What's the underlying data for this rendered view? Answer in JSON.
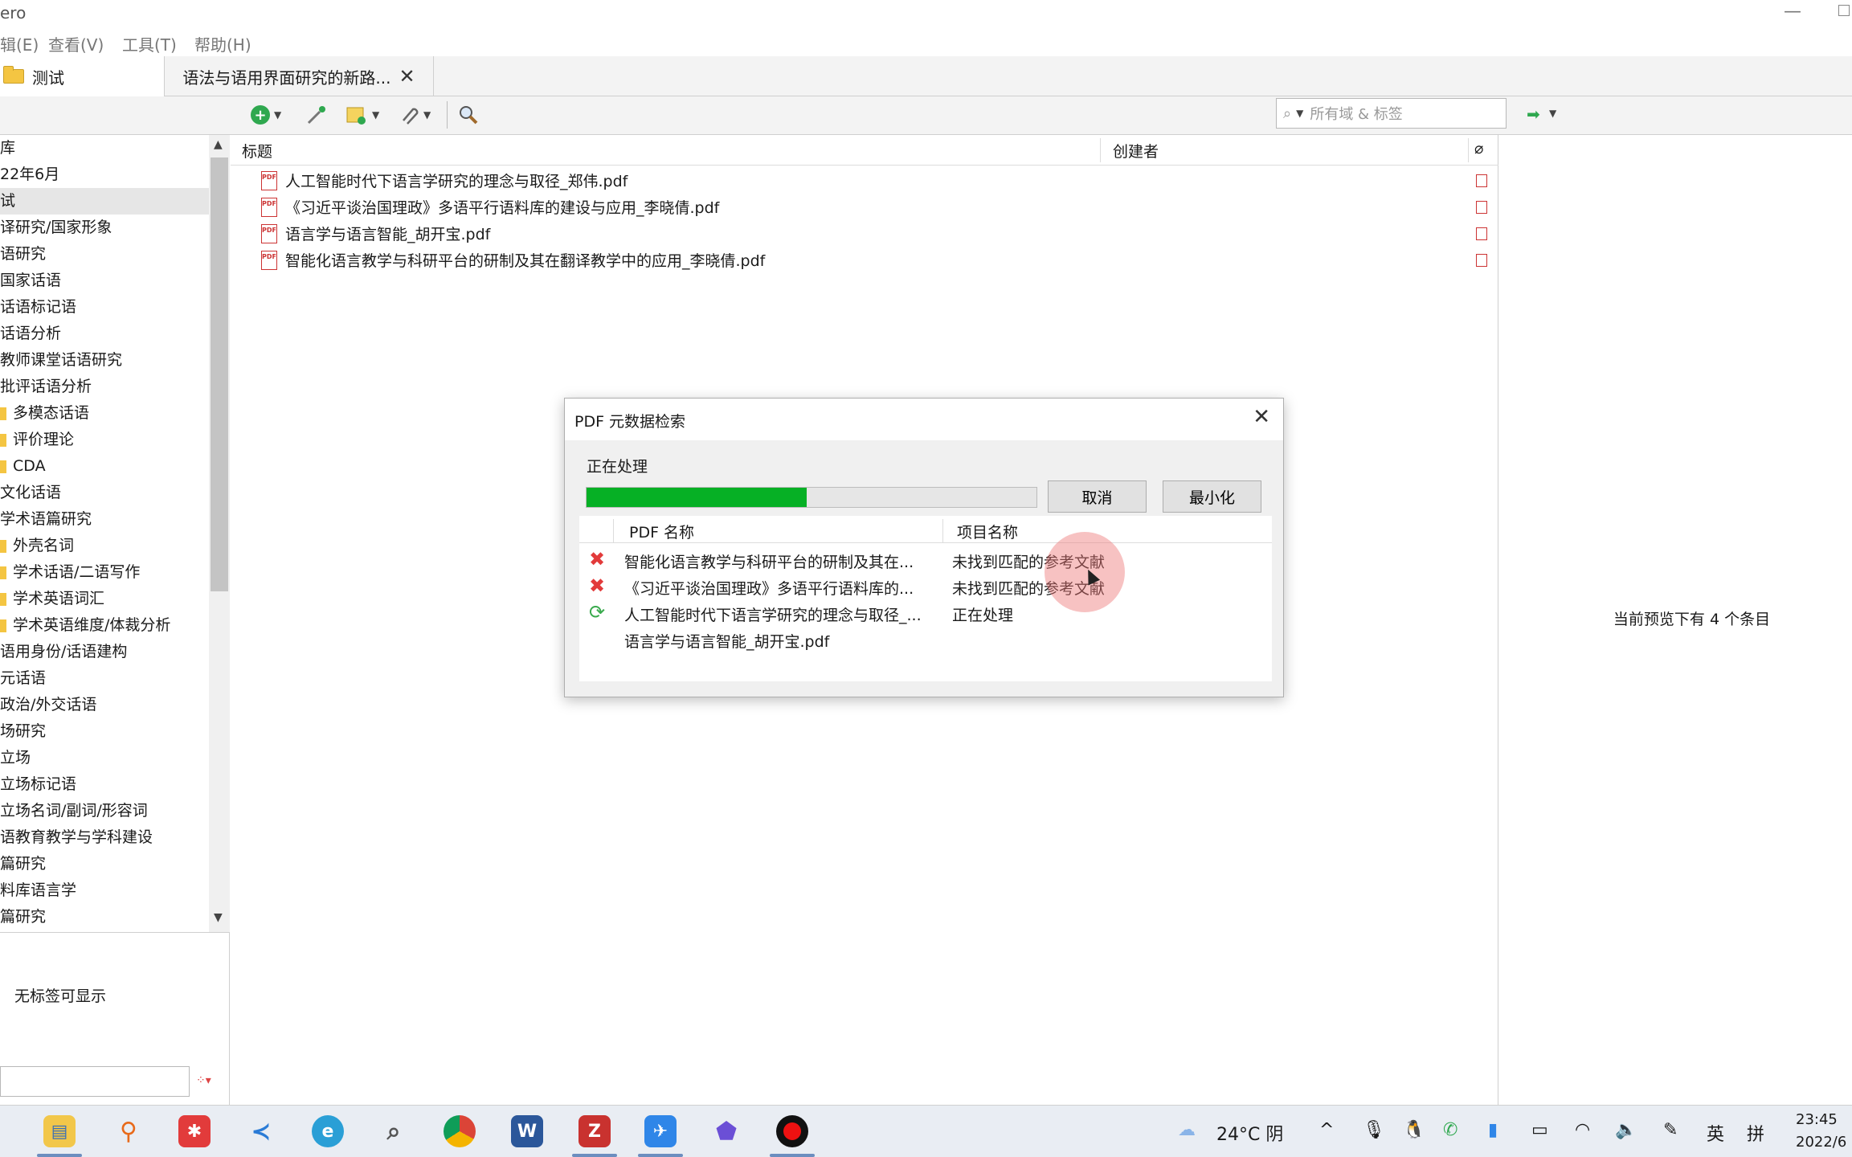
{
  "window": {
    "title": "ero"
  },
  "menu": {
    "items": [
      "辑(E)",
      "查看(V)",
      "工具(T)",
      "帮助(H)"
    ]
  },
  "tabs": [
    {
      "label": "测试"
    },
    {
      "label": "语法与语用界面研究的新路..."
    }
  ],
  "search": {
    "mode_placeholder": "所有域 & 标签"
  },
  "collections": [
    {
      "label": "库"
    },
    {
      "label": "22年6月"
    },
    {
      "label": "试"
    },
    {
      "label": "译研究/国家形象"
    },
    {
      "label": "语研究"
    },
    {
      "label": "国家话语"
    },
    {
      "label": "话语标记语"
    },
    {
      "label": "话语分析"
    },
    {
      "label": "教师课堂话语研究"
    },
    {
      "label": "批评话语分析"
    },
    {
      "label": "多模态话语"
    },
    {
      "label": "评价理论"
    },
    {
      "label": "CDA"
    },
    {
      "label": "文化话语"
    },
    {
      "label": "学术语篇研究"
    },
    {
      "label": "外壳名词"
    },
    {
      "label": "学术话语/二语写作"
    },
    {
      "label": "学术英语词汇"
    },
    {
      "label": "学术英语维度/体裁分析"
    },
    {
      "label": "语用身份/话语建构"
    },
    {
      "label": "元话语"
    },
    {
      "label": "政治/外交话语"
    },
    {
      "label": "场研究"
    },
    {
      "label": "立场"
    },
    {
      "label": "立场标记语"
    },
    {
      "label": "立场名词/副词/形容词"
    },
    {
      "label": "语教育教学与学科建设"
    },
    {
      "label": "篇研究"
    },
    {
      "label": "料库语言学"
    },
    {
      "label": "篇研究"
    }
  ],
  "tags": {
    "empty_text": "无标签可显示"
  },
  "items_table": {
    "columns": {
      "title": "标题",
      "creator": "创建者"
    },
    "rows": [
      {
        "title": "人工智能时代下语言学研究的理念与取径_郑伟.pdf",
        "creator": ""
      },
      {
        "title": "《习近平谈治国理政》多语平行语料库的建设与应用_李晓倩.pdf",
        "creator": ""
      },
      {
        "title": "语言学与语言智能_胡开宝.pdf",
        "creator": ""
      },
      {
        "title": "智能化语言教学与科研平台的研制及其在翻译教学中的应用_李晓倩.pdf",
        "creator": ""
      }
    ]
  },
  "preview": {
    "message": "当前预览下有 4 个条目"
  },
  "dialog": {
    "title": "PDF 元数据检索",
    "status": "正在处理",
    "progress": 0.49,
    "cancel_label": "取消",
    "minimize_label": "最小化",
    "columns": {
      "pdf_name": "PDF 名称",
      "item_name": "项目名称"
    },
    "rows": [
      {
        "state": "error",
        "pdf": "智能化语言教学与科研平台的研制及其在...",
        "item": "未找到匹配的参考文献"
      },
      {
        "state": "error",
        "pdf": "《习近平谈治国理政》多语平行语料库的...",
        "item": "未找到匹配的参考文献"
      },
      {
        "state": "processing",
        "pdf": "人工智能时代下语言学研究的理念与取径_...",
        "item": "正在处理"
      },
      {
        "state": "pending",
        "pdf": "语言学与语言智能_胡开宝.pdf",
        "item": ""
      }
    ]
  },
  "taskbar": {
    "weather": "24°C 阴",
    "ime_lang": "英",
    "ime_mode": "拼",
    "time": "23:45",
    "date": "2022/6"
  },
  "colors": {
    "progress": "#06b025",
    "error": "#e23b3b",
    "processing": "#3aaa4d"
  }
}
